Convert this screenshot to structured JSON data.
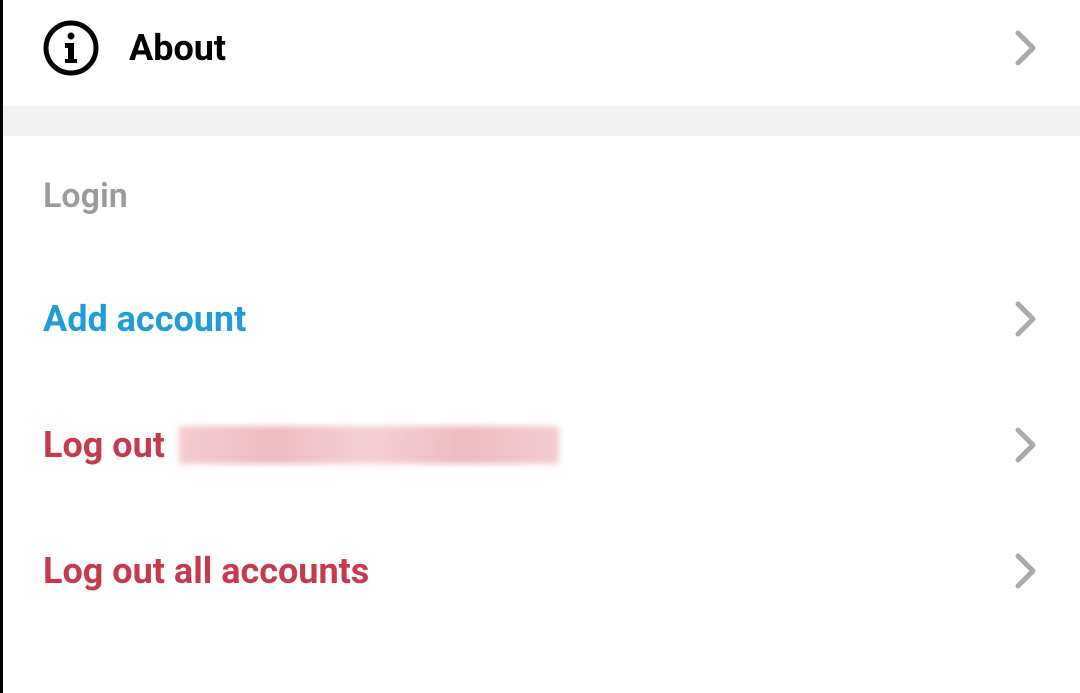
{
  "about": {
    "label": "About"
  },
  "login_section": {
    "header": "Login",
    "add_account_label": "Add account",
    "logout_label": "Log out",
    "logout_all_label": "Log out all accounts"
  }
}
